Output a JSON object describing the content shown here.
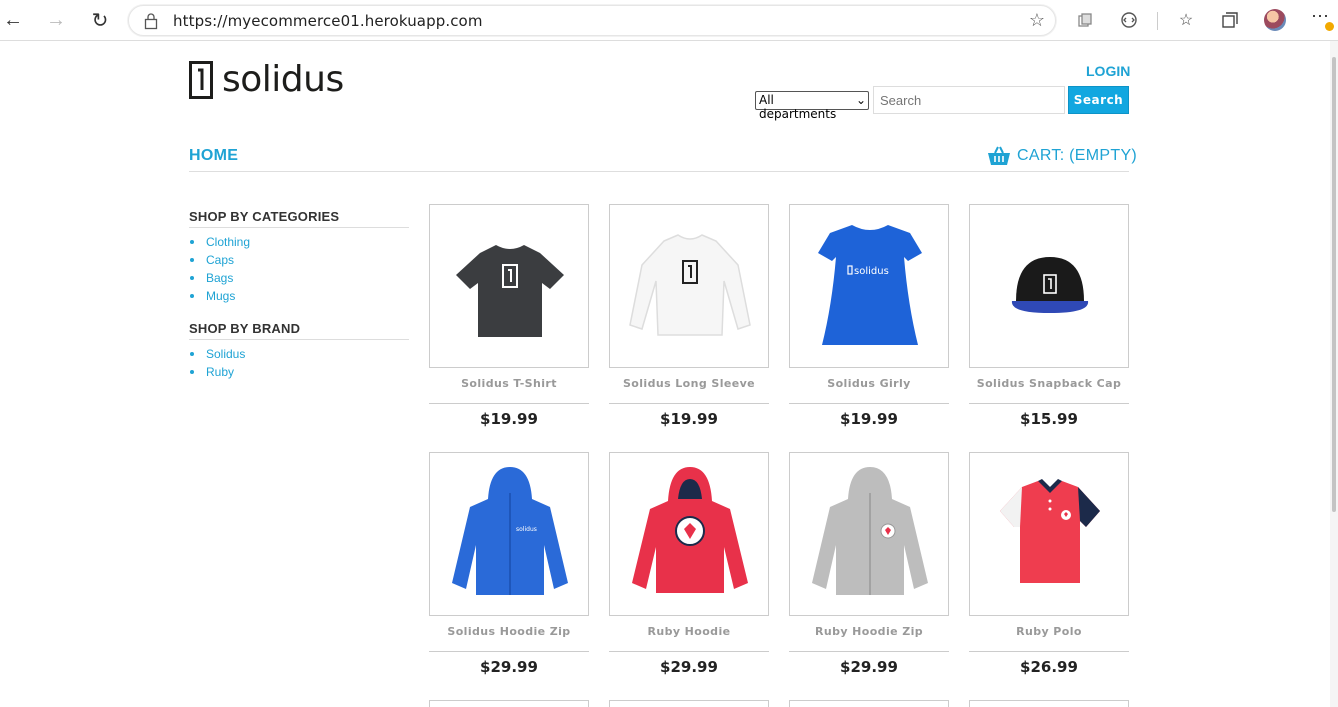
{
  "browser": {
    "url": "https://myecommerce01.herokuapp.com"
  },
  "store": {
    "logo_text": "solidus",
    "login_label": "LOGIN",
    "department_select": "All departments",
    "search_placeholder": "Search",
    "search_button": "Search",
    "nav_home": "HOME",
    "cart_label": "CART: (EMPTY)",
    "brand_color": "#1fa3d4"
  },
  "sidebar": {
    "categories_title": "SHOP BY CATEGORIES",
    "categories": [
      "Clothing",
      "Caps",
      "Bags",
      "Mugs"
    ],
    "brand_title": "SHOP BY BRAND",
    "brands": [
      "Solidus",
      "Ruby"
    ]
  },
  "products": [
    {
      "name": "Solidus T-Shirt",
      "price": "$19.99"
    },
    {
      "name": "Solidus Long Sleeve",
      "price": "$19.99"
    },
    {
      "name": "Solidus Girly",
      "price": "$19.99"
    },
    {
      "name": "Solidus Snapback Cap",
      "price": "$15.99"
    },
    {
      "name": "Solidus Hoodie Zip",
      "price": "$29.99"
    },
    {
      "name": "Ruby Hoodie",
      "price": "$29.99"
    },
    {
      "name": "Ruby Hoodie Zip",
      "price": "$29.99"
    },
    {
      "name": "Ruby Polo",
      "price": "$26.99"
    }
  ]
}
